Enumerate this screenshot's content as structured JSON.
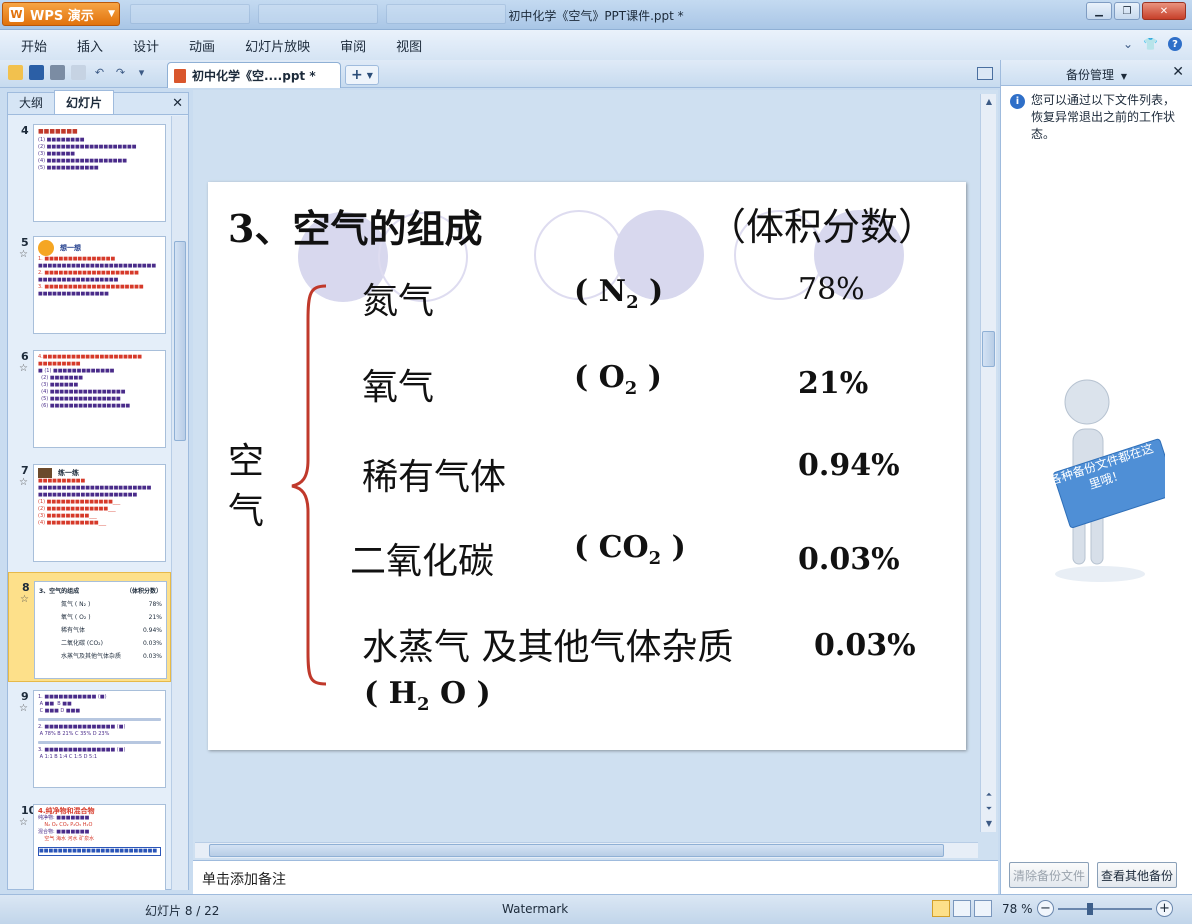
{
  "titlebar": {
    "app_button": "WPS 演示",
    "document_title": "初中化学《空气》PPT课件.ppt *"
  },
  "menu": {
    "items": [
      "开始",
      "插入",
      "设计",
      "动画",
      "幻灯片放映",
      "审阅",
      "视图"
    ]
  },
  "toolbar": {
    "doc_tab_label": "初中化学《空....ppt *",
    "new_tab": "+"
  },
  "left_panel": {
    "tabs": [
      "大纲",
      "幻灯片"
    ],
    "active_tab": "幻灯片",
    "slides": [
      {
        "num": "4",
        "selected": false,
        "star": false
      },
      {
        "num": "5",
        "selected": false,
        "star": true,
        "heading": "想一想"
      },
      {
        "num": "6",
        "selected": false,
        "star": true
      },
      {
        "num": "7",
        "selected": false,
        "star": true,
        "heading": "练一练"
      },
      {
        "num": "8",
        "selected": true,
        "star": true,
        "heading": "3、空气的组成",
        "sub": "（体积分数）"
      },
      {
        "num": "9",
        "selected": false,
        "star": true
      },
      {
        "num": "10",
        "selected": false,
        "star": true,
        "heading": "4.纯净物和混合物"
      }
    ]
  },
  "slide": {
    "title": "3、空气的组成",
    "subtitle": "（体积分数）",
    "air_label": "空气",
    "rows": [
      {
        "name": "氮气",
        "formula": "( N",
        "sub": "2",
        "close": " )",
        "percent": "78%"
      },
      {
        "name": "氧气",
        "formula": "( O",
        "sub": "2",
        "close": " )",
        "percent": "21%"
      },
      {
        "name": "稀有气体",
        "percent": "0.94%"
      },
      {
        "name": "二氧化碳",
        "formula": "( CO",
        "sub": "2",
        "close": " )",
        "percent": "0.03%"
      },
      {
        "name": "水蒸气 及其他气体杂质",
        "percent": "0.03%"
      }
    ],
    "h2o": {
      "open": "( H",
      "sub": "2",
      "rest": " O )"
    }
  },
  "notes": {
    "placeholder": "单击添加备注"
  },
  "backup_panel": {
    "title": "备份管理",
    "info": "您可以通过以下文件列表，恢复异常退出之前的工作状态。",
    "sign_text": "各种备份文件都在这里哦！",
    "clear_button": "清除备份文件",
    "view_button": "查看其他备份"
  },
  "statusbar": {
    "slide_indicator": "幻灯片 8 / 22",
    "theme": "Watermark",
    "zoom": "78 %"
  },
  "colors": {
    "title_orange": "#e1720c",
    "brace_red": "#c0392b",
    "circle_fill": "#d8d8ee",
    "selected_thumb": "#fde08a"
  }
}
